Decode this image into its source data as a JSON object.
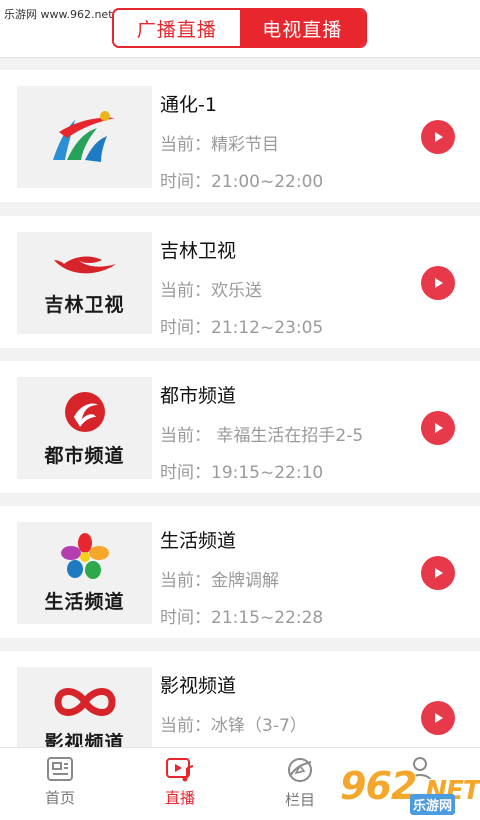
{
  "watermark": "乐游网 www.962.net",
  "header": {
    "tabs": [
      {
        "label": "广播直播",
        "active": false
      },
      {
        "label": "电视直播",
        "active": true
      }
    ]
  },
  "channels": [
    {
      "name": "通化-1",
      "now": "当前：精彩节目",
      "time": "时间：21:00~22:00",
      "logo": "tonghua-logo"
    },
    {
      "name": "吉林卫视",
      "now": "当前：欢乐送",
      "time": "时间：21:12~23:05",
      "logo": "jilin-tv-logo",
      "logo_text": "吉林卫视"
    },
    {
      "name": "都市频道",
      "now": "当前：  幸福生活在招手2-5",
      "time": "时间：19:15~22:10",
      "logo": "dushi-logo",
      "logo_text": "都市频道"
    },
    {
      "name": "生活频道",
      "now": "当前：金牌调解",
      "time": "时间：21:15~22:28",
      "logo": "shenghuo-logo",
      "logo_text": "生活频道"
    },
    {
      "name": "影视频道",
      "now": "当前：冰锋（3-7）",
      "time": "",
      "logo": "yingshi-logo",
      "logo_text": "影视频道"
    }
  ],
  "tabbar": {
    "items": [
      {
        "label": "首页",
        "icon": "news-icon",
        "active": false
      },
      {
        "label": "直播",
        "icon": "live-video-icon",
        "active": true
      },
      {
        "label": "栏目",
        "icon": "column-icon",
        "active": false
      },
      {
        "label": "",
        "icon": "user-icon",
        "active": false
      }
    ]
  },
  "brand": {
    "main": "962",
    "net": ".NET",
    "sub": "乐游网"
  },
  "colors": {
    "accent": "#e8262d",
    "play": "#e8394a",
    "muted": "#9a9a9a"
  }
}
